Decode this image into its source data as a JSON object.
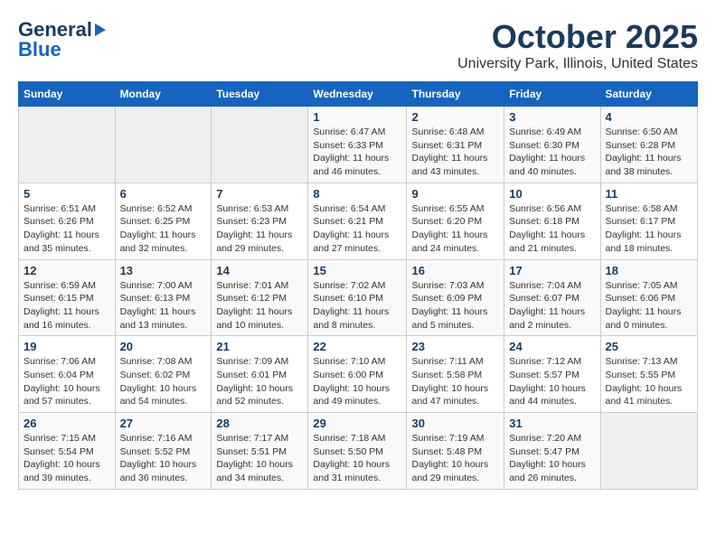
{
  "header": {
    "logo_line1": "General",
    "logo_line2": "Blue",
    "title": "October 2025",
    "subtitle": "University Park, Illinois, United States"
  },
  "days_of_week": [
    "Sunday",
    "Monday",
    "Tuesday",
    "Wednesday",
    "Thursday",
    "Friday",
    "Saturday"
  ],
  "weeks": [
    [
      {
        "day": "",
        "info": ""
      },
      {
        "day": "",
        "info": ""
      },
      {
        "day": "",
        "info": ""
      },
      {
        "day": "1",
        "info": "Sunrise: 6:47 AM\nSunset: 6:33 PM\nDaylight: 11 hours\nand 46 minutes."
      },
      {
        "day": "2",
        "info": "Sunrise: 6:48 AM\nSunset: 6:31 PM\nDaylight: 11 hours\nand 43 minutes."
      },
      {
        "day": "3",
        "info": "Sunrise: 6:49 AM\nSunset: 6:30 PM\nDaylight: 11 hours\nand 40 minutes."
      },
      {
        "day": "4",
        "info": "Sunrise: 6:50 AM\nSunset: 6:28 PM\nDaylight: 11 hours\nand 38 minutes."
      }
    ],
    [
      {
        "day": "5",
        "info": "Sunrise: 6:51 AM\nSunset: 6:26 PM\nDaylight: 11 hours\nand 35 minutes."
      },
      {
        "day": "6",
        "info": "Sunrise: 6:52 AM\nSunset: 6:25 PM\nDaylight: 11 hours\nand 32 minutes."
      },
      {
        "day": "7",
        "info": "Sunrise: 6:53 AM\nSunset: 6:23 PM\nDaylight: 11 hours\nand 29 minutes."
      },
      {
        "day": "8",
        "info": "Sunrise: 6:54 AM\nSunset: 6:21 PM\nDaylight: 11 hours\nand 27 minutes."
      },
      {
        "day": "9",
        "info": "Sunrise: 6:55 AM\nSunset: 6:20 PM\nDaylight: 11 hours\nand 24 minutes."
      },
      {
        "day": "10",
        "info": "Sunrise: 6:56 AM\nSunset: 6:18 PM\nDaylight: 11 hours\nand 21 minutes."
      },
      {
        "day": "11",
        "info": "Sunrise: 6:58 AM\nSunset: 6:17 PM\nDaylight: 11 hours\nand 18 minutes."
      }
    ],
    [
      {
        "day": "12",
        "info": "Sunrise: 6:59 AM\nSunset: 6:15 PM\nDaylight: 11 hours\nand 16 minutes."
      },
      {
        "day": "13",
        "info": "Sunrise: 7:00 AM\nSunset: 6:13 PM\nDaylight: 11 hours\nand 13 minutes."
      },
      {
        "day": "14",
        "info": "Sunrise: 7:01 AM\nSunset: 6:12 PM\nDaylight: 11 hours\nand 10 minutes."
      },
      {
        "day": "15",
        "info": "Sunrise: 7:02 AM\nSunset: 6:10 PM\nDaylight: 11 hours\nand 8 minutes."
      },
      {
        "day": "16",
        "info": "Sunrise: 7:03 AM\nSunset: 6:09 PM\nDaylight: 11 hours\nand 5 minutes."
      },
      {
        "day": "17",
        "info": "Sunrise: 7:04 AM\nSunset: 6:07 PM\nDaylight: 11 hours\nand 2 minutes."
      },
      {
        "day": "18",
        "info": "Sunrise: 7:05 AM\nSunset: 6:06 PM\nDaylight: 11 hours\nand 0 minutes."
      }
    ],
    [
      {
        "day": "19",
        "info": "Sunrise: 7:06 AM\nSunset: 6:04 PM\nDaylight: 10 hours\nand 57 minutes."
      },
      {
        "day": "20",
        "info": "Sunrise: 7:08 AM\nSunset: 6:02 PM\nDaylight: 10 hours\nand 54 minutes."
      },
      {
        "day": "21",
        "info": "Sunrise: 7:09 AM\nSunset: 6:01 PM\nDaylight: 10 hours\nand 52 minutes."
      },
      {
        "day": "22",
        "info": "Sunrise: 7:10 AM\nSunset: 6:00 PM\nDaylight: 10 hours\nand 49 minutes."
      },
      {
        "day": "23",
        "info": "Sunrise: 7:11 AM\nSunset: 5:58 PM\nDaylight: 10 hours\nand 47 minutes."
      },
      {
        "day": "24",
        "info": "Sunrise: 7:12 AM\nSunset: 5:57 PM\nDaylight: 10 hours\nand 44 minutes."
      },
      {
        "day": "25",
        "info": "Sunrise: 7:13 AM\nSunset: 5:55 PM\nDaylight: 10 hours\nand 41 minutes."
      }
    ],
    [
      {
        "day": "26",
        "info": "Sunrise: 7:15 AM\nSunset: 5:54 PM\nDaylight: 10 hours\nand 39 minutes."
      },
      {
        "day": "27",
        "info": "Sunrise: 7:16 AM\nSunset: 5:52 PM\nDaylight: 10 hours\nand 36 minutes."
      },
      {
        "day": "28",
        "info": "Sunrise: 7:17 AM\nSunset: 5:51 PM\nDaylight: 10 hours\nand 34 minutes."
      },
      {
        "day": "29",
        "info": "Sunrise: 7:18 AM\nSunset: 5:50 PM\nDaylight: 10 hours\nand 31 minutes."
      },
      {
        "day": "30",
        "info": "Sunrise: 7:19 AM\nSunset: 5:48 PM\nDaylight: 10 hours\nand 29 minutes."
      },
      {
        "day": "31",
        "info": "Sunrise: 7:20 AM\nSunset: 5:47 PM\nDaylight: 10 hours\nand 26 minutes."
      },
      {
        "day": "",
        "info": ""
      }
    ]
  ]
}
